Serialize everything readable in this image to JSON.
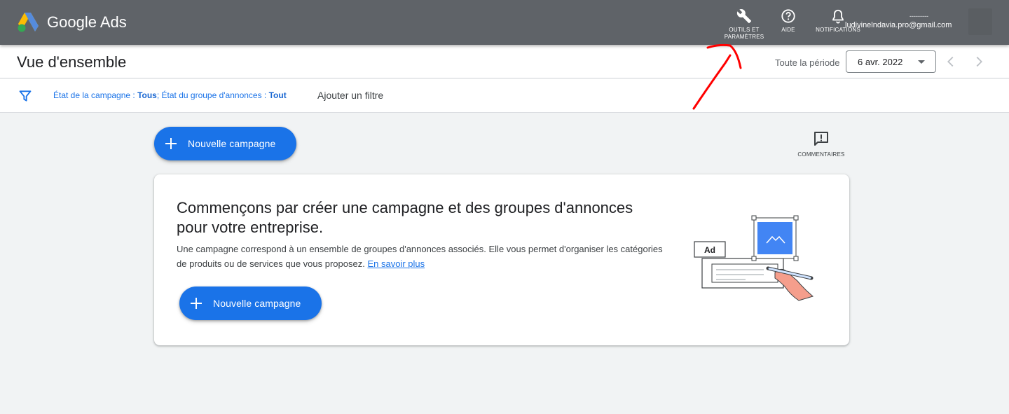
{
  "topbar": {
    "brand": "Google Ads",
    "tools_label": "OUTILS ET PARAMÈTRES",
    "help_label": "AIDE",
    "notifications_label": "NOTIFICATIONS",
    "account_email": "ludivinelndavia.pro@gmail.com",
    "account_id_partial": "---------"
  },
  "header": {
    "title": "Vue d'ensemble",
    "period_label": "Toute la période",
    "date_value": "6 avr. 2022"
  },
  "filters": {
    "campaign_state_label": "État de la campagne : ",
    "campaign_state_value": "Tous",
    "separator": "; ",
    "adgroup_state_label": "État du groupe d'annonces : ",
    "adgroup_state_value": "Tout",
    "add_filter": "Ajouter un filtre"
  },
  "actions": {
    "new_campaign": "Nouvelle campagne",
    "comments": "COMMENTAIRES"
  },
  "card": {
    "title": "Commençons par créer une campagne et des groupes d'annonces pour votre entreprise.",
    "description": "Une campagne correspond à un ensemble de groupes d'annonces associés. Elle vous permet d'organiser les catégories de produits ou de services que vous proposez. ",
    "learn_more": "En savoir plus",
    "button": "Nouvelle campagne",
    "illustration_tag": "Ad"
  },
  "colors": {
    "topbar": "#5f6368",
    "primary": "#1a73e8",
    "annotation": "#ff0000",
    "background": "#f1f3f4"
  }
}
